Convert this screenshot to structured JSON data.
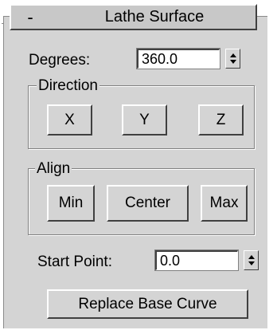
{
  "rollout": {
    "collapse_symbol": "-",
    "title": "Lathe Surface"
  },
  "degrees": {
    "label": "Degrees:",
    "value": "360.0"
  },
  "direction": {
    "group_label": "Direction",
    "buttons": [
      "X",
      "Y",
      "Z"
    ]
  },
  "align": {
    "group_label": "Align",
    "buttons": [
      "Min",
      "Center",
      "Max"
    ]
  },
  "start_point": {
    "label": "Start Point:",
    "value": "0.0"
  },
  "replace_base_curve": {
    "label": "Replace Base Curve"
  },
  "icons": {
    "spinner": "spinner-arrows-icon"
  },
  "colors": {
    "panel_bg": "#d4d4d4",
    "header_bg": "#c8c8c8",
    "field_bg": "#ffffff"
  }
}
